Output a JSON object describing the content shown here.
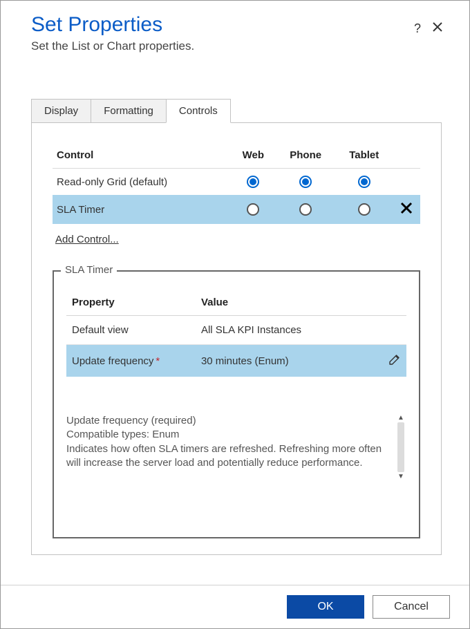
{
  "header": {
    "title": "Set Properties",
    "subtitle": "Set the List or Chart properties."
  },
  "tabs": [
    {
      "label": "Display",
      "active": false
    },
    {
      "label": "Formatting",
      "active": false
    },
    {
      "label": "Controls",
      "active": true
    }
  ],
  "controls_table": {
    "headers": {
      "control": "Control",
      "web": "Web",
      "phone": "Phone",
      "tablet": "Tablet"
    },
    "rows": [
      {
        "name": "Read-only Grid (default)",
        "selected": false,
        "deletable": false,
        "checked": true
      },
      {
        "name": "SLA Timer",
        "selected": true,
        "deletable": true,
        "checked": false
      }
    ],
    "add_label": "Add Control..."
  },
  "properties_panel": {
    "legend": "SLA Timer",
    "headers": {
      "property": "Property",
      "value": "Value"
    },
    "rows": [
      {
        "property": "Default view",
        "value": "All SLA KPI Instances",
        "required": false,
        "selected": false
      },
      {
        "property": "Update frequency",
        "value": "30 minutes (Enum)",
        "required": true,
        "selected": true
      }
    ],
    "description": {
      "line1": "Update frequency (required)",
      "line2": "Compatible types: Enum",
      "body": "Indicates how often SLA timers are refreshed. Refreshing more often will increase the server load and potentially reduce performance."
    }
  },
  "footer": {
    "ok": "OK",
    "cancel": "Cancel"
  }
}
